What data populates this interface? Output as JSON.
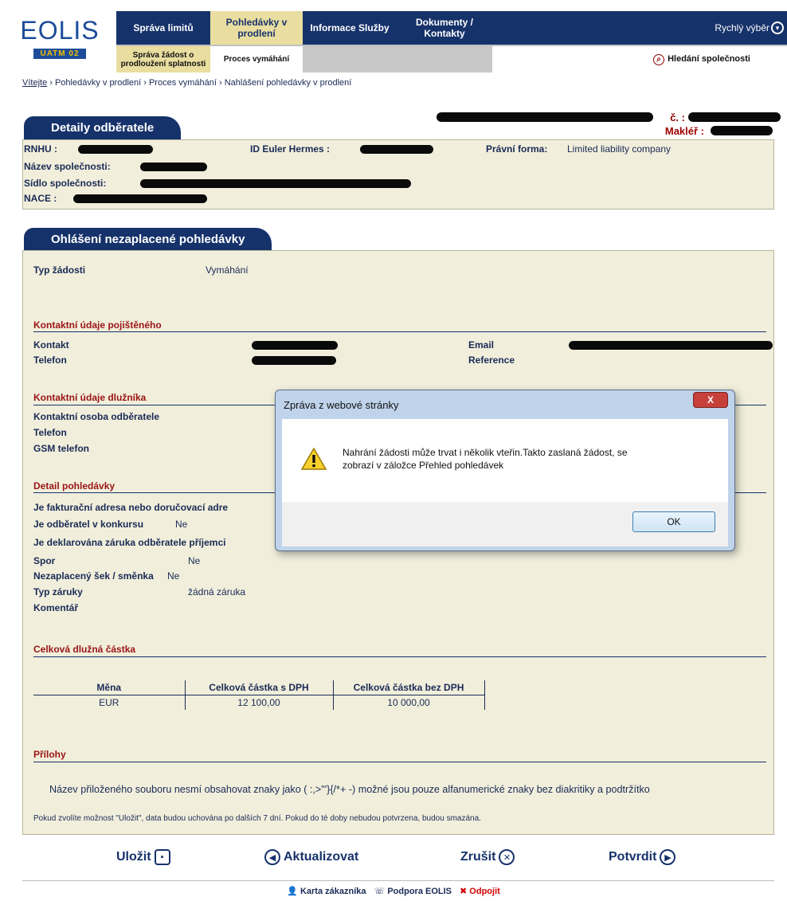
{
  "header": {
    "logo_brand": "EOLIS",
    "logo_sub": "UATM 02",
    "nav": [
      {
        "label": "Správa limitů"
      },
      {
        "label": "Pohledávky v prodlení"
      },
      {
        "label": "Informace Služby"
      },
      {
        "label": "Dokumenty / Kontakty"
      }
    ],
    "quick_select": "Rychlý výběr",
    "subnav": [
      {
        "label": "Správa žádost o prodloužení splatnosti"
      },
      {
        "label": "Proces vymáhání"
      }
    ],
    "company_search": "Hledání společnosti"
  },
  "breadcrumb": {
    "home": "Vítejte",
    "rest": " › Pohledávky v prodlení › Proces vymáhání › Nahlášení pohledávky v prodlení"
  },
  "top_right": {
    "contract_label": "č. :",
    "broker_label": "Makléř :"
  },
  "customer": {
    "tab": "Detaily odběratele",
    "rnhu_label": "RNHU :",
    "id_label": "ID Euler Hermes :",
    "legal_form_label": "Právní forma:",
    "legal_form_value": "Limited liability company",
    "name_label": "Název společnosti:",
    "seat_label": "Sídlo společnosti:",
    "nace_label": "NACE :"
  },
  "report": {
    "tab": "Ohlášení nezaplacené pohledávky",
    "request_type_label": "Typ žádosti",
    "request_type_value": "Vymáhání",
    "insured_section": "Kontaktní údaje pojištěného",
    "contact_label": "Kontakt",
    "phone_label": "Telefon",
    "email_label": "Email",
    "reference_label": "Reference",
    "debtor_section": "Kontaktní údaje dlužníka",
    "debtor_contact_label": "Kontaktní osoba odběratele",
    "debtor_phone_label": "Telefon",
    "debtor_gsm_label": "GSM telefon",
    "detail_section": "Detail pohledávky",
    "q_address": "Je fakturační adresa nebo doručovací adre",
    "q_bankruptcy": "Je odběratel v konkursu",
    "q_bankruptcy_value": "Ne",
    "q_guarantee": "Je deklarována záruka odběratele příjemci",
    "dispute_label": "Spor",
    "dispute_value": "Ne",
    "cheque_label": "Nezaplacený šek / směnka",
    "cheque_value": "Ne",
    "guarantee_type_label": "Typ záruky",
    "guarantee_type_value": "žádná záruka",
    "comment_label": "Komentář",
    "total_section": "Celková dlužná částka",
    "table": {
      "headers": [
        "Měna",
        "Celková částka s DPH",
        "Celková částka bez DPH"
      ],
      "rows": [
        [
          "EUR",
          "12 100,00",
          "10 000,00"
        ]
      ]
    },
    "attachments_section": "Přílohy",
    "attachment_note": "Název přiloženého souboru nesmí obsahovat znaky jako ( :,>\"'}{/*+ -) možné jsou pouze alfanumerické znaky bez diakritiky a podtržítko",
    "save_note": "Pokud zvolíte možnost \"Uložit\", data budou uchována po dalších 7 dní. Pokud do té doby nebudou potvrzena, budou smazána."
  },
  "actions": {
    "save": "Uložit",
    "update": "Aktualizovat",
    "cancel": "Zrušit",
    "confirm": "Potvrdit"
  },
  "footer": {
    "customer_card": "Karta zákazníka",
    "support": "Podpora EOLIS",
    "logout": "Odpojit"
  },
  "dialog": {
    "title": "Zpráva z webové stránky",
    "close": "X",
    "message_line1": "Nahrání žádosti může trvat i několik vteřin.Takto zaslaná žádost, se",
    "message_line2": "zobrazí v záložce  Přehled pohledávek",
    "ok": "OK"
  }
}
